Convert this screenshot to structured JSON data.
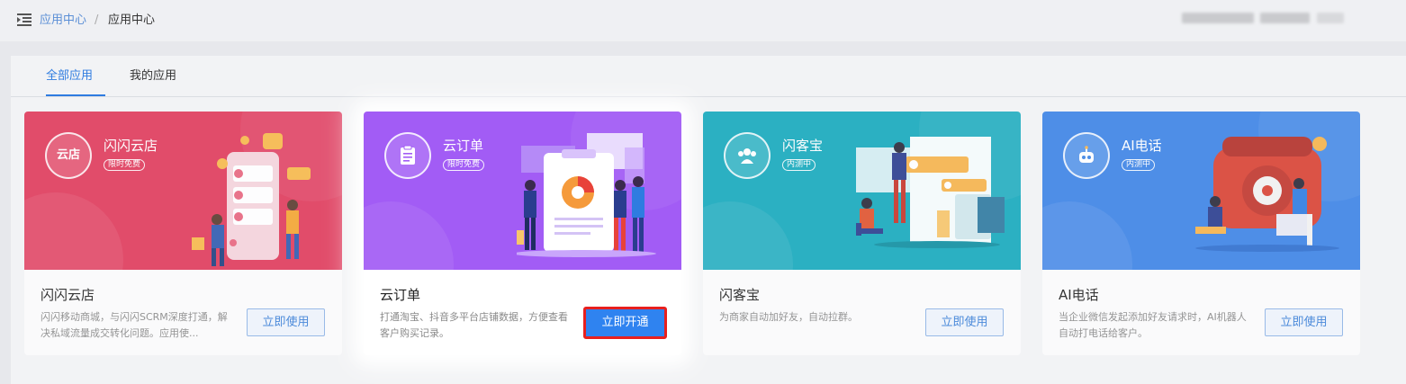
{
  "breadcrumb": {
    "parent": "应用中心",
    "separator": "/",
    "current": "应用中心"
  },
  "tabs": [
    {
      "label": "全部应用",
      "active": true
    },
    {
      "label": "我的应用",
      "active": false
    }
  ],
  "colors": {
    "accent": "#2f7ce0",
    "highlight_border": "#e8201e"
  },
  "apps": [
    {
      "name": "闪闪云店",
      "logo_text": "云店",
      "badge": "限时免费",
      "title": "闪闪云店",
      "description": "闪闪移动商城，与闪闪SCRM深度打通，解决私域流量成交转化问题。应用使...",
      "button": "立即使用",
      "hero_color": "#e03a5c",
      "icon": "store-icon"
    },
    {
      "name": "云订单",
      "logo_text": "",
      "badge": "限时免费",
      "title": "云订单",
      "description": "打通淘宝、抖音多平台店铺数据，方便查看客户购买记录。",
      "button": "立即开通",
      "hero_color": "#a25cf5",
      "icon": "clipboard-icon"
    },
    {
      "name": "闪客宝",
      "logo_text": "",
      "badge": "内测中",
      "title": "闪客宝",
      "description": "为商家自动加好友，自动拉群。",
      "button": "立即使用",
      "hero_color": "#16a9bd",
      "icon": "group-icon"
    },
    {
      "name": "AI电话",
      "logo_text": "",
      "badge": "内测中",
      "title": "AI电话",
      "description": "当企业微信发起添加好友请求时，AI机器人自动打电话给客户。",
      "button": "立即使用",
      "hero_color": "#3d84e6",
      "icon": "robot-icon"
    }
  ]
}
